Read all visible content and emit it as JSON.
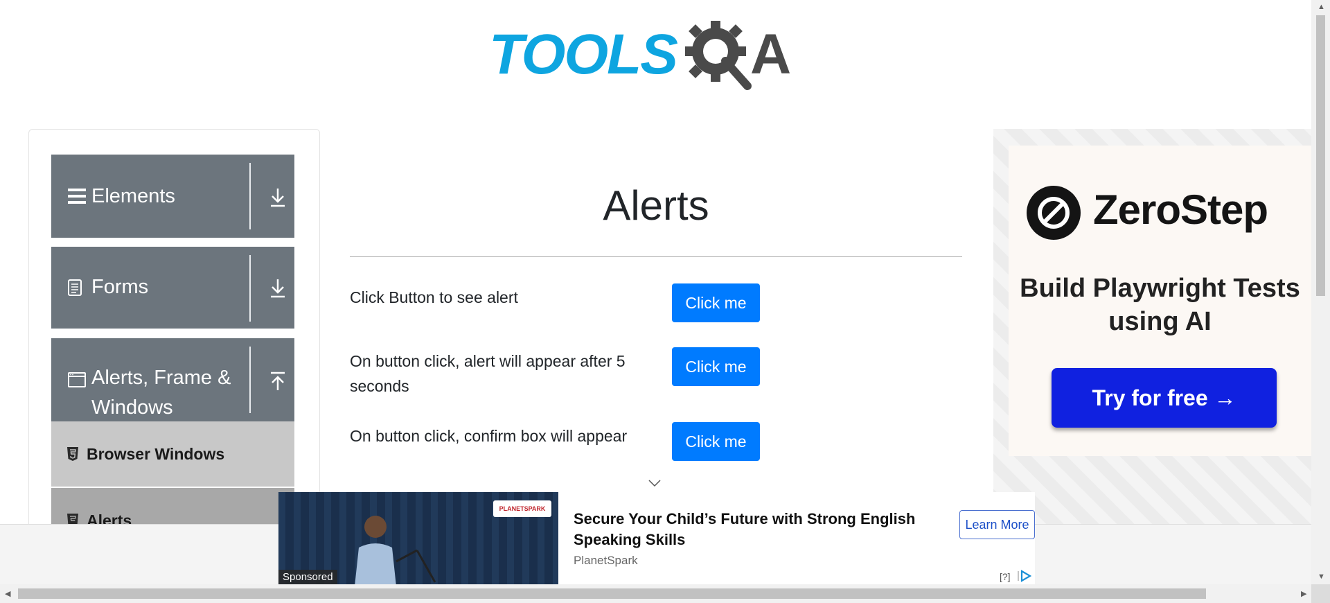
{
  "logo": {
    "tools_text": "TOOLS",
    "qa_letter": "A"
  },
  "nav": {
    "groups": [
      {
        "label": "Elements"
      },
      {
        "label": "Forms"
      },
      {
        "label": "Alerts, Frame & Windows"
      }
    ],
    "sub_items": [
      {
        "label": "Browser Windows"
      },
      {
        "label": "Alerts"
      }
    ]
  },
  "main": {
    "title": "Alerts",
    "rows": [
      {
        "text": "Click Button to see alert",
        "button": "Click me"
      },
      {
        "text": "On button click, alert will appear after 5 seconds",
        "button": "Click me"
      },
      {
        "text": "On button click, confirm box will appear",
        "button": "Click me"
      }
    ]
  },
  "ad_right": {
    "brand": "ZeroStep",
    "tagline": "Build Playwright Tests using AI",
    "cta": "Try for free →"
  },
  "sponsored": {
    "label": "Sponsored",
    "image_brand": "PLANETSPARK",
    "headline": "Secure Your Child’s Future with Strong English Speaking Skills",
    "source": "PlanetSpark",
    "cta": "Learn More",
    "help": "[?]"
  },
  "colors": {
    "nav_group_bg": "#6c757d",
    "nav_sub_bg": "#c8c8c8",
    "primary_button": "#007bff",
    "logo_blue": "#0ea5e0",
    "zerostep_button": "#1021e0"
  }
}
